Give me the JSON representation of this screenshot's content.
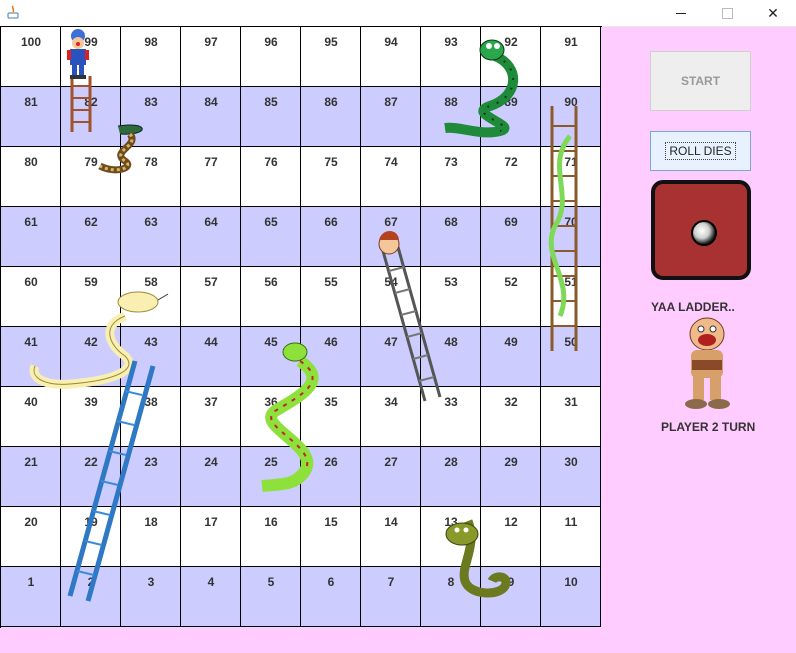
{
  "window": {
    "minimize_glyph": "minimize",
    "maximize_glyph": "maximize",
    "close_glyph": "✕"
  },
  "board": {
    "rows": [
      [
        100,
        99,
        98,
        97,
        96,
        95,
        94,
        93,
        92,
        91
      ],
      [
        81,
        82,
        83,
        84,
        85,
        86,
        87,
        88,
        89,
        90
      ],
      [
        80,
        79,
        78,
        77,
        76,
        75,
        74,
        73,
        72,
        71
      ],
      [
        61,
        62,
        63,
        64,
        65,
        66,
        67,
        68,
        69,
        70
      ],
      [
        60,
        59,
        58,
        57,
        56,
        55,
        54,
        53,
        52,
        51
      ],
      [
        41,
        42,
        43,
        44,
        45,
        46,
        47,
        48,
        49,
        50
      ],
      [
        40,
        39,
        38,
        37,
        36,
        35,
        34,
        33,
        32,
        31
      ],
      [
        21,
        22,
        23,
        24,
        25,
        26,
        27,
        28,
        29,
        30
      ],
      [
        20,
        19,
        18,
        17,
        16,
        15,
        14,
        13,
        12,
        11
      ],
      [
        1,
        2,
        3,
        4,
        5,
        6,
        7,
        8,
        9,
        10
      ]
    ],
    "colors": {
      "light_row": "#ffffff",
      "dark_row": "#ccccff",
      "panel_bg": "#ffccff",
      "die": "#a83232"
    }
  },
  "controls": {
    "start_label": "START",
    "roll_label": "ROLL DIES",
    "die_value": 1
  },
  "status": {
    "message": "YAA LADDER..",
    "turn": "PLAYER 2 TURN"
  }
}
